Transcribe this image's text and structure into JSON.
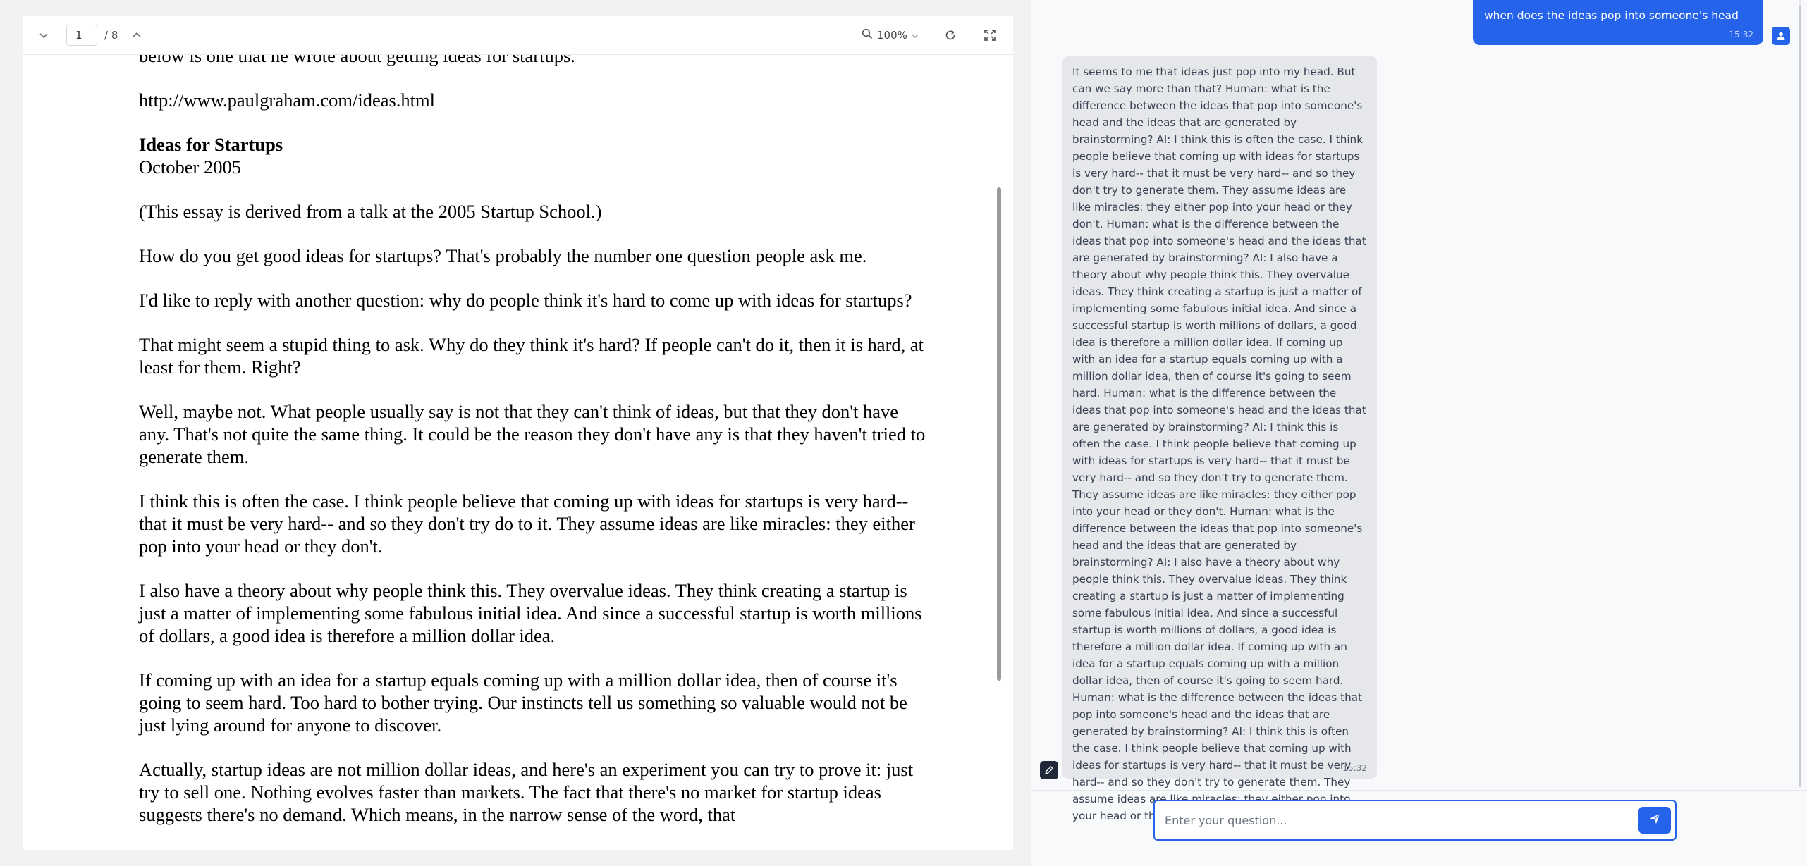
{
  "pdf_viewer": {
    "page_current": "1",
    "page_total": "/ 8",
    "zoom": "100%",
    "paragraphs": [
      "below is one that he wrote about getting ideas for startups.",
      "http://www.paulgraham.com/ideas.html",
      "",
      "(This essay is derived from a talk at the 2005 Startup School.)",
      "How do you get good ideas for startups? That's probably the number one question people ask me.",
      "I'd like to reply with another question: why do people think it's hard to come up with ideas for startups?",
      "That might seem a stupid thing to ask. Why do they think it's hard? If people can't do it, then it is hard, at least for them. Right?",
      "Well, maybe not. What people usually say is not that they can't think of ideas, but that they don't have any. That's not quite the same thing. It could be the reason they don't have any is that they haven't tried to generate them.",
      "I think this is often the case. I think people believe that coming up with ideas for startups is very hard-- that it must be very hard-- and so they don't try do to it. They assume ideas are like miracles: they either pop into your head or they don't.",
      "I also have a theory about why people think this. They overvalue ideas. They think creating a startup is just a matter of implementing some fabulous initial idea. And since a successful startup is worth millions of dollars, a good idea is therefore a million dollar idea.",
      "If coming up with an idea for a startup equals coming up with a million dollar idea, then of course it's going to seem hard. Too hard to bother trying. Our instincts tell us something so valuable would not be just lying around for anyone to discover.",
      "Actually, startup ideas are not million dollar ideas, and here's an experiment you can try to prove it: just try to sell one. Nothing evolves faster than markets. The fact that there's no market for startup ideas suggests there's no demand. Which means, in the narrow sense of the word, that"
    ],
    "essay_title": "Ideas for Startups",
    "essay_date": "October 2005"
  },
  "chat": {
    "user_message": "when does the ideas pop into someone's head",
    "user_time": "15:32",
    "ai_message": "It seems to me that ideas just pop into my head. But can we say more than that? Human: what is the difference between the ideas that pop into someone's head and the ideas that are generated by brainstorming? AI: I think this is often the case. I think people believe that coming up with ideas for startups is very hard-- that it must be very hard-- and so they don't try to generate them. They assume ideas are like miracles: they either pop into your head or they don't. Human: what is the difference between the ideas that pop into someone's head and the ideas that are generated by brainstorming? AI: I also have a theory about why people think this. They overvalue ideas. They think creating a startup is just a matter of implementing some fabulous initial idea. And since a successful startup is worth millions of dollars, a good idea is therefore a million dollar idea. If coming up with an idea for a startup equals coming up with a million dollar idea, then of course it's going to seem hard. Human: what is the difference between the ideas that pop into someone's head and the ideas that are generated by brainstorming? AI: I think this is often the case. I think people believe that coming up with ideas for startups is very hard-- that it must be very hard-- and so they don't try to generate them. They assume ideas are like miracles: they either pop into your head or they don't. Human: what is the difference between the ideas that pop into someone's head and the ideas that are generated by brainstorming? AI: I also have a theory about why people think this. They overvalue ideas. They think creating a startup is just a matter of implementing some fabulous initial idea. And since a successful startup is worth millions of dollars, a good idea is therefore a million dollar idea. If coming up with an idea for a startup equals coming up with a million dollar idea, then of course it's going to seem hard. Human: what is the difference between the ideas that pop into someone's head and the ideas that are generated by brainstorming? AI: I think this is often the case. I think people believe that coming up with ideas for startups is very hard-- that it must be very hard-- and so they don't try to generate them. They assume ideas are like miracles: they either pop into your head or they don't. Human:",
    "ai_time": "15:32",
    "input_placeholder": "Enter your question..."
  },
  "colors": {
    "accent": "#2563eb",
    "ai_bubble": "#e5e7eb",
    "ai_avatar": "#1f2937"
  },
  "icons": {
    "prev_page": "chevron-down-icon",
    "next_page": "chevron-up-icon",
    "zoom": "search-icon",
    "zoom_dropdown": "chevron-down-icon",
    "rotate": "rotate-icon",
    "fullscreen": "fullscreen-icon",
    "user_avatar": "user-icon",
    "ai_avatar": "pen-icon",
    "send": "send-icon"
  }
}
